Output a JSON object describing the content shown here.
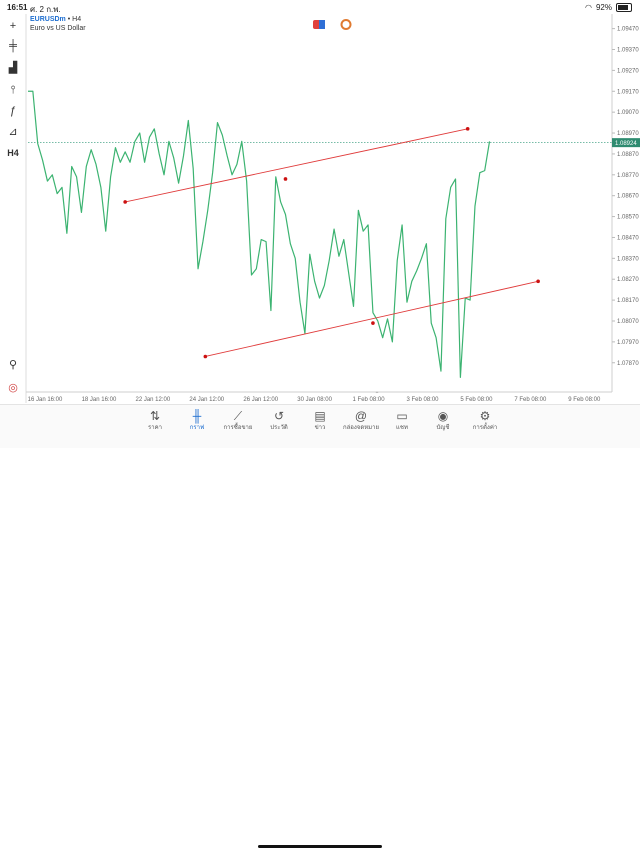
{
  "status_bar": {
    "time": "16:51",
    "date": "ศ. 2 ก.พ.",
    "wifi_icon": "wifi-icon",
    "battery": "92%"
  },
  "symbol": {
    "ticker": "EURUSDm",
    "sep": "•",
    "timeframe": "H4",
    "description": "Euro vs US Dollar"
  },
  "toolbar": {
    "items": [
      {
        "name": "crosshair-icon",
        "glyph": "+"
      },
      {
        "name": "candle-type-icon",
        "glyph": "╪"
      },
      {
        "name": "indicators-icon",
        "glyph": "▟"
      },
      {
        "name": "objects-icon",
        "glyph": "⫯"
      },
      {
        "name": "function-icon",
        "glyph": "ƒ"
      },
      {
        "name": "shapes-icon",
        "glyph": "⊿"
      },
      {
        "name": "period-label",
        "glyph": "H4"
      }
    ],
    "bottom": [
      {
        "name": "search-icon",
        "glyph": "⚲"
      },
      {
        "name": "app-logo-icon",
        "glyph": "◎"
      }
    ]
  },
  "top_buttons": {
    "trade_icon": "trade-button-icon",
    "history_icon": "indicator-circle-icon"
  },
  "chart_data": {
    "type": "line",
    "title": "",
    "xlabel": "",
    "ylabel": "",
    "ylim": [
      1.0773,
      1.0954
    ],
    "yticks": [
      "1.09470",
      "1.09370",
      "1.09270",
      "1.09170",
      "1.09070",
      "1.08970",
      "1.08870",
      "1.08770",
      "1.08670",
      "1.08570",
      "1.08470",
      "1.08370",
      "1.08270",
      "1.08170",
      "1.08070",
      "1.07970",
      "1.07870"
    ],
    "ytick_values": [
      1.0947,
      1.0937,
      1.0927,
      1.0917,
      1.0907,
      1.0897,
      1.0887,
      1.0877,
      1.0867,
      1.0857,
      1.0847,
      1.0837,
      1.0827,
      1.0817,
      1.0807,
      1.0797,
      1.0787
    ],
    "xticks": [
      "16 Jan 16:00",
      "18 Jan 16:00",
      "22 Jan 12:00",
      "24 Jan 12:00",
      "26 Jan 12:00",
      "30 Jan 08:00",
      "1 Feb 08:00",
      "3 Feb 08:00",
      "5 Feb 08:00",
      "7 Feb 08:00",
      "9 Feb 08:00"
    ],
    "xtick_index": [
      3.5,
      14.6,
      25.7,
      36.8,
      47.9,
      59,
      70.1,
      81.2,
      92.3,
      103.4,
      114.5
    ],
    "current_price": "1.08924",
    "current_price_value": 1.08924,
    "series": [
      {
        "color": "#3cb371",
        "values": [
          1.0917,
          1.0917,
          1.0892,
          1.0884,
          1.0874,
          1.0877,
          1.0868,
          1.0871,
          1.0849,
          1.0881,
          1.0876,
          1.0859,
          1.0881,
          1.0889,
          1.0882,
          1.0871,
          1.085,
          1.0876,
          1.089,
          1.0883,
          1.0888,
          1.0883,
          1.0893,
          1.0897,
          1.0883,
          1.0895,
          1.0899,
          1.0887,
          1.0877,
          1.0893,
          1.0885,
          1.0873,
          1.0886,
          1.0903,
          1.088,
          1.0832,
          1.0845,
          1.086,
          1.0878,
          1.0902,
          1.0896,
          1.0886,
          1.0877,
          1.0882,
          1.0893,
          1.0874,
          1.0829,
          1.0832,
          1.0846,
          1.0845,
          1.0812,
          1.0876,
          1.0864,
          1.0858,
          1.0844,
          1.0837,
          1.0816,
          1.0801,
          1.0839,
          1.0826,
          1.0818,
          1.0824,
          1.0836,
          1.0851,
          1.0838,
          1.0846,
          1.083,
          1.0814,
          1.086,
          1.085,
          1.0853,
          1.0811,
          1.0807,
          1.0799,
          1.0808,
          1.0797,
          1.0836,
          1.0853,
          1.0816,
          1.0826,
          1.0831,
          1.0837,
          1.0844,
          1.0806,
          1.0799,
          1.0783,
          1.0856,
          1.0871,
          1.0875,
          1.078,
          1.0818,
          1.0817,
          1.0862,
          1.0878,
          1.0879,
          1.0893
        ]
      }
    ],
    "trendlines": [
      {
        "color": "#e03c3c",
        "points": [
          [
            20,
            1.0864
          ],
          [
            53,
            1.0875
          ],
          [
            90.5,
            1.0899
          ]
        ]
      },
      {
        "color": "#e03c3c",
        "points": [
          [
            36.5,
            1.079
          ],
          [
            71,
            1.0806
          ],
          [
            105,
            1.0826
          ]
        ]
      }
    ]
  },
  "tabbar": {
    "tabs": [
      {
        "name": "tab-quotes",
        "icon": "⇅",
        "label": "ราคา",
        "active": false
      },
      {
        "name": "tab-chart",
        "icon": "╫",
        "label": "กราฟ",
        "active": true
      },
      {
        "name": "tab-trade",
        "icon": "⟋",
        "label": "การซื้อขาย",
        "active": false
      },
      {
        "name": "tab-history",
        "icon": "↺",
        "label": "ประวัติ",
        "active": false
      },
      {
        "name": "tab-news",
        "icon": "▤",
        "label": "ข่าว",
        "active": false
      },
      {
        "name": "tab-mailbox",
        "icon": "@",
        "label": "กล่องจดหมาย",
        "active": false
      },
      {
        "name": "tab-chat",
        "icon": "▭",
        "label": "แชท",
        "active": false
      },
      {
        "name": "tab-accounts",
        "icon": "◉",
        "label": "บัญชี",
        "active": false
      },
      {
        "name": "tab-settings",
        "icon": "⚙",
        "label": "การตั้งค่า",
        "active": false
      }
    ]
  }
}
